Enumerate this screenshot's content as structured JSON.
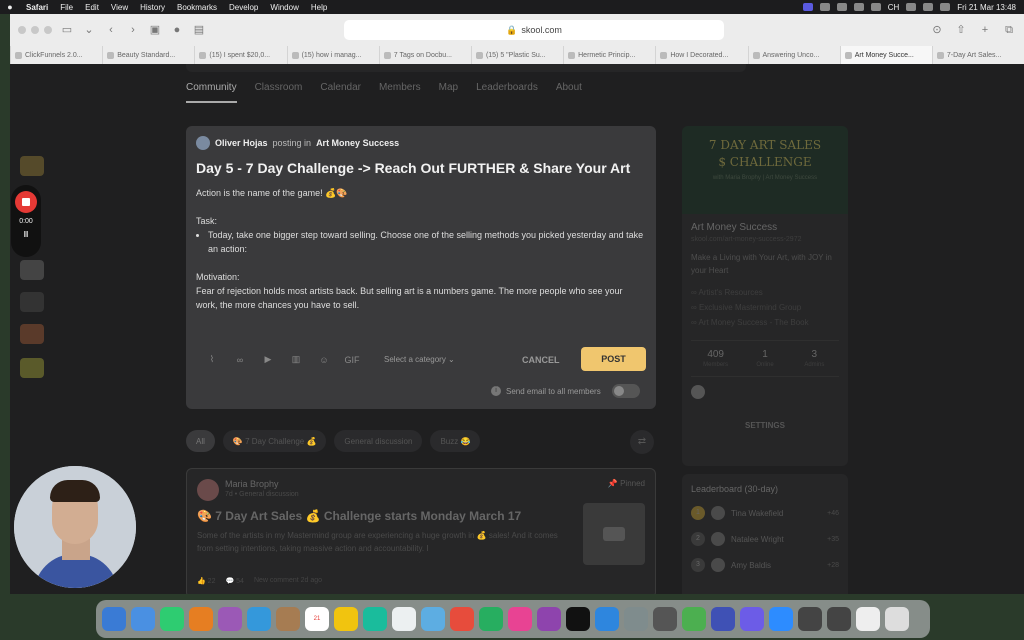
{
  "menubar": {
    "app": "Safari",
    "items": [
      "File",
      "Edit",
      "View",
      "History",
      "Bookmarks",
      "Develop",
      "Window",
      "Help"
    ],
    "status_ch": "CH",
    "datetime": "Fri 21 Mar  13:48"
  },
  "browser": {
    "url": "skool.com",
    "tabs": [
      "ClickFunnels 2.0...",
      "Beauty Standard...",
      "(15) I spent $20,0...",
      "(15) how i manag...",
      "7 Tags on Docbu...",
      "(15) 5 \"Plastic Su...",
      "Hermetic Princip...",
      "How I Decorated...",
      "Answering Unco...",
      "Art Money Succe...",
      "7-Day Art Sales..."
    ]
  },
  "nav": {
    "items": [
      "Community",
      "Classroom",
      "Calendar",
      "Members",
      "Map",
      "Leaderboards",
      "About"
    ]
  },
  "editor": {
    "author": "Oliver Hojas",
    "posting_in": "posting in",
    "group": "Art Money Success",
    "title": "Day 5 - 7 Day Challenge -> Reach Out FURTHER & Share Your Art",
    "intro": "Action is the name of the game! 💰🎨",
    "task_label": "Task:",
    "task_item": "Today, take one bigger step toward selling. Choose one of the selling methods you picked yesterday and take an action:",
    "motivation_label": "Motivation:",
    "motivation_text": "Fear of rejection holds most artists back. But selling art is a numbers game. The more people who see your work, the more chances you have to sell.",
    "gif_label": "GIF",
    "category_placeholder": "Select a category",
    "cancel_label": "CANCEL",
    "post_label": "POST",
    "send_email_label": "Send email to all members"
  },
  "chips": {
    "all": "All",
    "items": [
      "🎨 7 Day Challenge 💰",
      "General discussion",
      "Buzz 😂"
    ]
  },
  "pinned": {
    "author": "Maria Brophy",
    "meta": "7d • General discussion",
    "pinned_label": "Pinned",
    "title": "🎨 7 Day Art Sales 💰 Challenge starts Monday March 17",
    "text": "Some of the artists in my Mastermind group are experiencing a huge growth in 💰 sales! And it comes from setting intentions, taking massive action and accountability. I",
    "likes": "22",
    "comments": "54",
    "new_comment": "New comment 2d ago"
  },
  "group_card": {
    "banner_line1": "7 DAY ART SALES",
    "banner_line2": "$ CHALLENGE",
    "banner_line3": "with Maria Brophy  |  Art Money Success",
    "name": "Art Money Success",
    "url": "skool.com/art-money-success-2972",
    "desc": "Make a Living with Your Art, with JOY in your Heart",
    "links": [
      "Artist's Resources",
      "Exclusive Mastermind Group",
      "Art Money Success - The Book"
    ],
    "stats": [
      {
        "n": "409",
        "l": "Members"
      },
      {
        "n": "1",
        "l": "Online"
      },
      {
        "n": "3",
        "l": "Admins"
      }
    ],
    "settings_label": "SETTINGS"
  },
  "leaderboard": {
    "title": "Leaderboard (30-day)",
    "rows": [
      {
        "rank": "1",
        "name": "Tina Wakefield",
        "pts": "+46"
      },
      {
        "rank": "2",
        "name": "Natalee Wright",
        "pts": "+35"
      },
      {
        "rank": "3",
        "name": "Amy Baldis",
        "pts": "+28"
      }
    ]
  },
  "recorder": {
    "time": "0:00",
    "pause": "II"
  },
  "dock": {
    "calendar_day": "21"
  }
}
